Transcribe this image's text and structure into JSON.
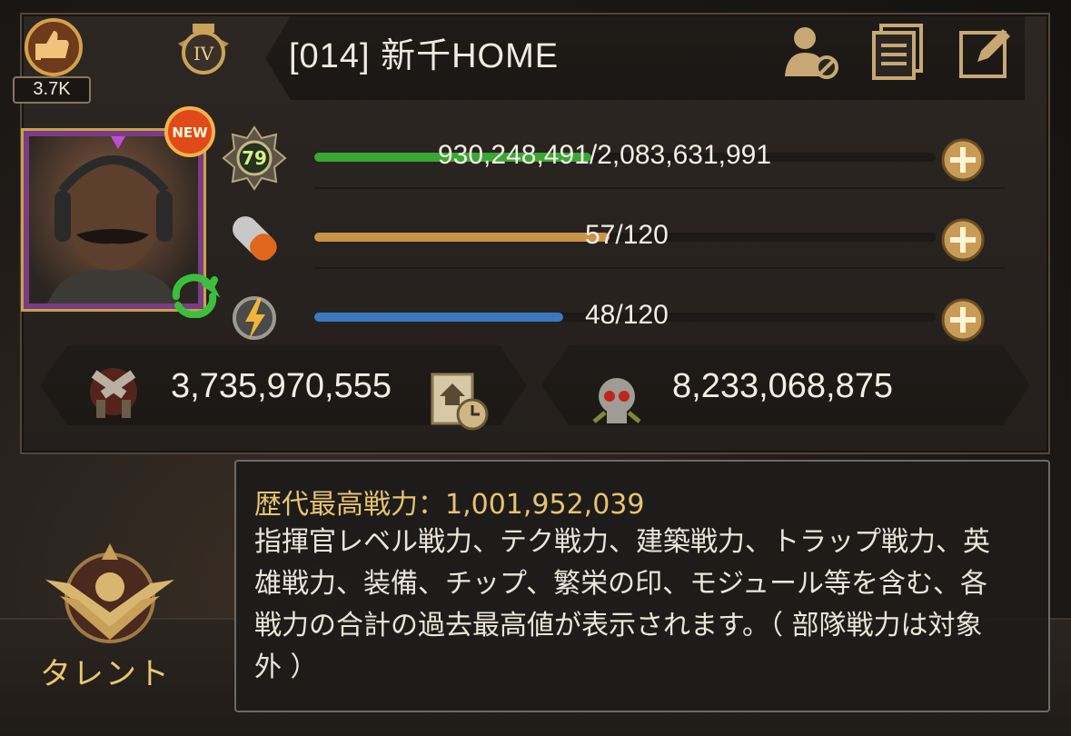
{
  "header": {
    "likes": "3.7K",
    "rank_roman": "IV",
    "player_name": "[014]  新千HOME"
  },
  "stats": {
    "level": "79",
    "exp_text": "930,248,491/2,083,631,991",
    "exp_fraction": 0.446,
    "stamina_text": "57/120",
    "stamina_fraction": 0.475,
    "energy_text": "48/120",
    "energy_fraction": 0.4
  },
  "power": {
    "total": "3,735,970,555",
    "kills": "8,233,068,875"
  },
  "badge": {
    "new": "NEW"
  },
  "tooltip": {
    "title": "歴代最高戦力：1,001,952,039",
    "body": "指揮官レベル戦力、テク戦力、建築戦力、トラップ戦力、英雄戦力、装備、チップ、繁栄の印、モジュール等を含む、各戦力の合計の過去最高値が表示されます。（ 部隊戦力は対象外 ）"
  },
  "nav": {
    "talent_label": "タレント"
  },
  "colors": {
    "exp_bar": "#3aa635",
    "stamina_bar": "#c99448",
    "energy_bar": "#3b78c2",
    "gold": "#e7c36f"
  }
}
